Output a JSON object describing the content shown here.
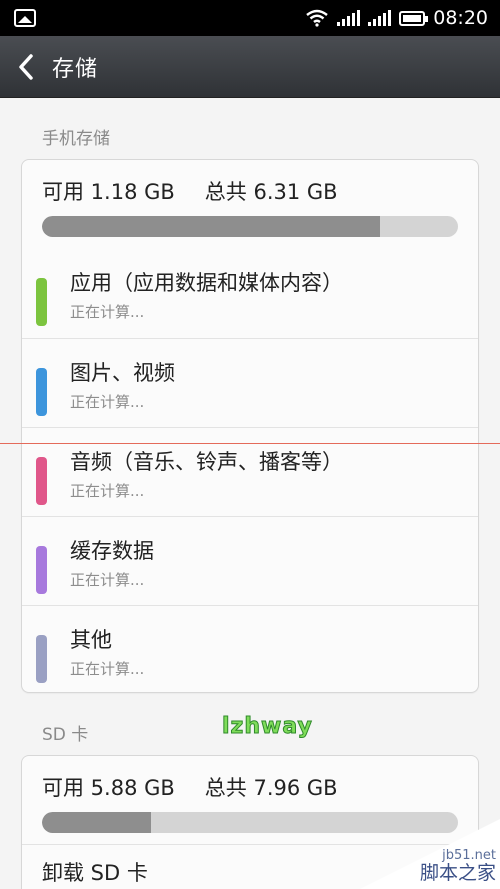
{
  "status": {
    "time": "08:20"
  },
  "header": {
    "title": "存储"
  },
  "phone": {
    "section_label": "手机存储",
    "available": "可用 1.18 GB",
    "total": "总共 6.31 GB",
    "used_fraction": 0.813,
    "items": [
      {
        "title": "应用（应用数据和媒体内容）",
        "subtitle": "正在计算...",
        "color": "#7cc43f"
      },
      {
        "title": "图片、视频",
        "subtitle": "正在计算...",
        "color": "#3d95dc"
      },
      {
        "title": "音频（音乐、铃声、播客等）",
        "subtitle": "正在计算...",
        "color": "#e0578a"
      },
      {
        "title": "缓存数据",
        "subtitle": "正在计算...",
        "color": "#a779dd"
      },
      {
        "title": "其他",
        "subtitle": "正在计算...",
        "color": "#9aa0c3"
      }
    ]
  },
  "sd": {
    "section_label": "SD 卡",
    "available": "可用 5.88 GB",
    "total": "总共 7.96 GB",
    "used_fraction": 0.261,
    "unmount_label": "卸载 SD 卡"
  },
  "watermarks": {
    "center_logo": "lzhway",
    "corner_url": "jb51.net",
    "corner_text": "脚本之家"
  }
}
